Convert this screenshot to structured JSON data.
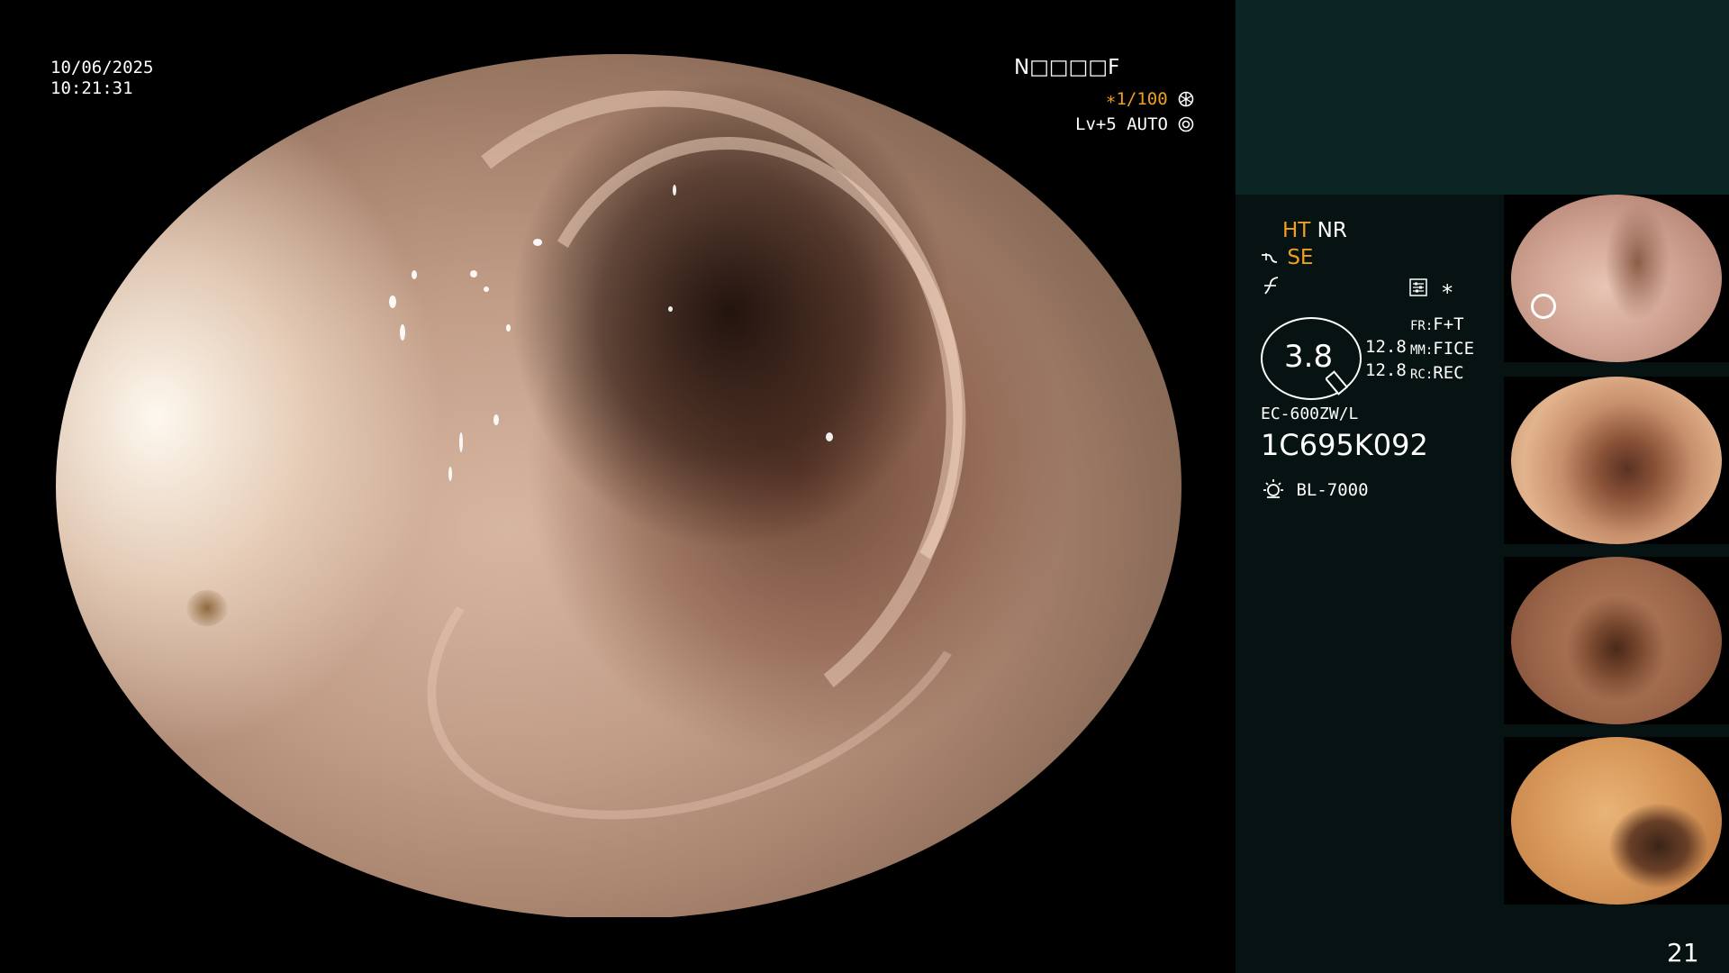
{
  "screen": {
    "date": "10/06/2025",
    "time": "10:21:31",
    "patient_code": "N□□□□F",
    "shutter": "∗1/100",
    "shutter_icon": "aperture-icon",
    "light_level": "Lv+5 AUTO",
    "light_icon": "iris-icon",
    "page_number": "21"
  },
  "panel": {
    "ht": "HT",
    "nr": "NR",
    "se": "SE",
    "se_icon": "wave-icon",
    "f_icon": "f-curve-icon",
    "settings_icon": "sliders-icon",
    "star": "∗",
    "zoom_value": "3.8",
    "val_a": "12.8",
    "val_b": "12.8",
    "fr_label": "FR:",
    "fr_value": "F+T",
    "mm_label": "MM:",
    "mm_value": "FICE",
    "rc_label": "RC:",
    "rc_value": "REC",
    "scope_model": "EC-600ZW/L",
    "serial": "1C695K092",
    "light_source": "BL-7000",
    "light_source_icon": "lamp-icon"
  },
  "colors": {
    "osd_orange": "#f0a020",
    "panel_bg": "#061312",
    "panel_band": "#0a2523"
  }
}
